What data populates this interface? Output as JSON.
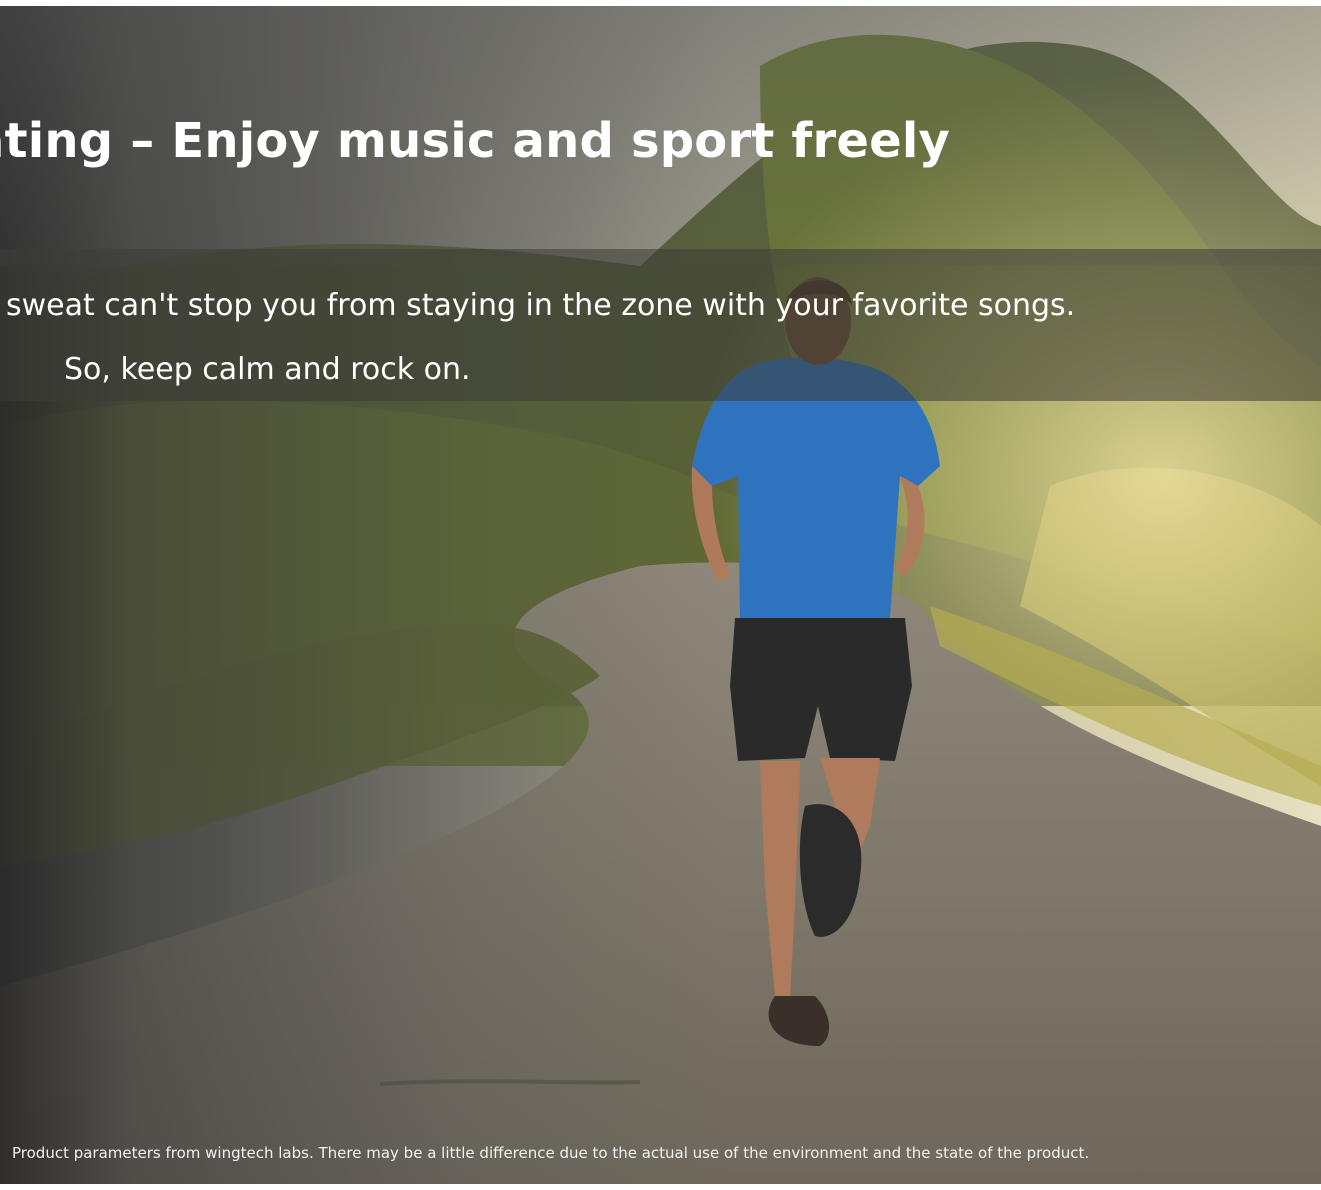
{
  "banner": {
    "headline": "ating – Enjoy music and sport freely",
    "caption_line_1": "sweat can't stop you from staying in the zone with your favorite songs.",
    "caption_line_2": "So, keep calm and rock on.",
    "disclaimer": "Product parameters from wingtech labs. There may be a little difference due to the actual use of the environment and the state of the product."
  },
  "scene": {
    "subject": "runner-photo",
    "colors": {
      "shirt": "#2f73bf",
      "shorts": "#2a2a2a",
      "road": "#8a8274",
      "foliage": "#5e6b2f",
      "sky": "#e8e2c8"
    }
  }
}
